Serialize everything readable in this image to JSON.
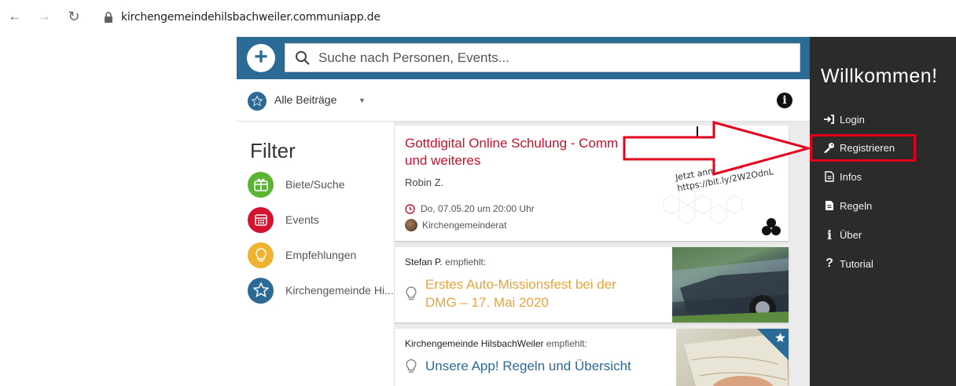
{
  "browser": {
    "url": "kirchengemeindehilsbachweiler.communiapp.de"
  },
  "search": {
    "placeholder": "Suche nach Personen, Events..."
  },
  "filterbar": {
    "selected": "Alle Beiträge"
  },
  "filter": {
    "title": "Filter",
    "items": [
      {
        "label": "Biete/Suche",
        "color": "#5cb532"
      },
      {
        "label": "Events",
        "color": "#d6132c"
      },
      {
        "label": "Empfehlungen",
        "color": "#f0b330"
      },
      {
        "label": "Kirchengemeinde Hi...",
        "color": "#2c6a96"
      }
    ]
  },
  "cards": [
    {
      "title": "Gottdigital Online Schulung - Comm und weiteres",
      "author": "Robin Z.",
      "date": "Do, 07.05.20 um 20:00 Uhr",
      "org": "Kirchengemeinderat",
      "image_text_line1": "Jetzt anmelden!",
      "image_text_line2": "https://bit.ly/2W2OdnL"
    },
    {
      "recommender": "Stefan P.",
      "recommend_suffix": "empfiehlt:",
      "title": "Erstes Auto-Missionsfest bei der DMG – 17. Mai 2020"
    },
    {
      "recommender": "Kirchengemeinde HilsbachWeiler",
      "recommend_suffix": "empfiehlt:",
      "title": "Unsere App! Regeln und Übersicht"
    }
  ],
  "sidebar": {
    "title": "Willkommen!",
    "items": [
      {
        "label": "Login",
        "icon": "login-icon"
      },
      {
        "label": "Registrieren",
        "icon": "key-icon"
      },
      {
        "label": "Infos",
        "icon": "document-icon"
      },
      {
        "label": "Regeln",
        "icon": "document-icon"
      },
      {
        "label": "Über",
        "icon": "info-icon"
      },
      {
        "label": "Tutorial",
        "icon": "question-icon"
      }
    ]
  },
  "colors": {
    "brand": "#2c6a96",
    "sidebar": "#2b2b2b",
    "highlight": "#e3001b"
  }
}
